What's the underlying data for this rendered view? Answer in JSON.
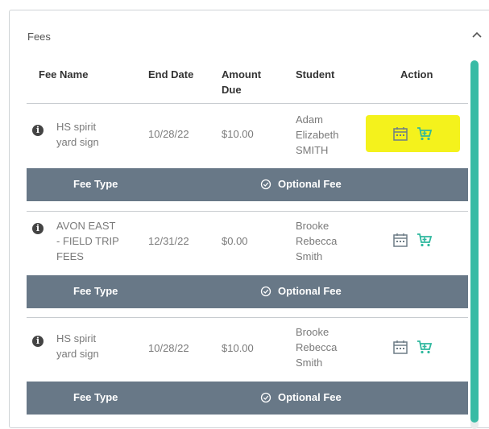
{
  "panel": {
    "title": "Fees"
  },
  "columns": {
    "fee_name": "Fee Name",
    "end_date": "End Date",
    "amount_due_line1": "Amount",
    "amount_due_line2": "Due",
    "student": "Student",
    "action": "Action"
  },
  "rows": [
    {
      "fee_name_l1": "HS spirit",
      "fee_name_l2": "yard sign",
      "fee_name_l3": "",
      "end_date": "10/28/22",
      "amount": "$10.00",
      "student_l1": "Adam",
      "student_l2": "Elizabeth",
      "student_l3": "SMITH",
      "type_label": "Fee Type",
      "type_value": "Optional Fee"
    },
    {
      "fee_name_l1": "AVON EAST",
      "fee_name_l2": "- FIELD TRIP",
      "fee_name_l3": "FEES",
      "end_date": "12/31/22",
      "amount": "$0.00",
      "student_l1": "Brooke",
      "student_l2": "Rebecca",
      "student_l3": "Smith",
      "type_label": "Fee Type",
      "type_value": "Optional Fee"
    },
    {
      "fee_name_l1": "HS spirit",
      "fee_name_l2": "yard sign",
      "fee_name_l3": "",
      "end_date": "10/28/22",
      "amount": "$10.00",
      "student_l1": "Brooke",
      "student_l2": "Rebecca",
      "student_l3": "Smith",
      "type_label": "Fee Type",
      "type_value": "Optional Fee"
    }
  ],
  "icons": {
    "info": "info-icon",
    "calendar": "calendar-icon",
    "cart": "shopping-cart-icon",
    "check": "check-circle-icon",
    "collapse": "chevron-up-icon"
  },
  "colors": {
    "accent": "#38bba5",
    "type_bar": "#687887",
    "highlight": "#f4f21c",
    "text_muted": "#7a7a7a"
  }
}
